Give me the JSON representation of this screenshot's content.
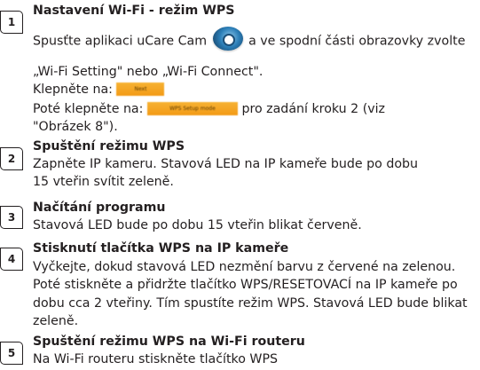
{
  "steps": [
    {
      "number": "1",
      "title": "Nastavení Wi-Fi - režim WPS",
      "line1_pre": "Spusťte aplikaci uCare Cam",
      "line1_post": "a ve spodní části obrazovky zvolte",
      "icon": "ucare-cam-app-icon",
      "line2": "„Wi-Fi Setting\" nebo „Wi-Fi Connect\".",
      "line3_pre": "Klepněte na:",
      "next_button_label": "Next",
      "line4_pre": "Poté klepněte na:",
      "wps_button_label": "WPS Setup mode",
      "line4_post": "pro zadání kroku 2 (viz",
      "line5": "\"Obrázek 8\")."
    },
    {
      "number": "2",
      "title": "Spuštění režimu WPS",
      "lines": [
        "Zapněte IP kameru. Stavová LED na IP kameře bude po dobu",
        "15 vteřin svítit zeleně."
      ]
    },
    {
      "number": "3",
      "title": "Načítání programu",
      "lines": [
        "Stavová LED bude po dobu 15 vteřin blikat červeně."
      ]
    },
    {
      "number": "4",
      "title": "Stisknutí tlačítka WPS na IP kameře",
      "lines": [
        "Vyčkejte, dokud stavová LED nezmění barvu z červené na zelenou.",
        "Poté stiskněte a přidržte tlačítko WPS/RESETOVACÍ na IP kameře po",
        "dobu cca 2 vteřiny. Tím spustíte režim WPS. Stavová LED bude blikat",
        "zeleně."
      ]
    },
    {
      "number": "5",
      "title": "Spuštění režimu WPS na Wi-Fi routeru",
      "lines": [
        "Na Wi-Fi routeru stiskněte tlačítko WPS"
      ]
    }
  ],
  "colors": {
    "text": "#231f20",
    "button": "#f5a623"
  }
}
